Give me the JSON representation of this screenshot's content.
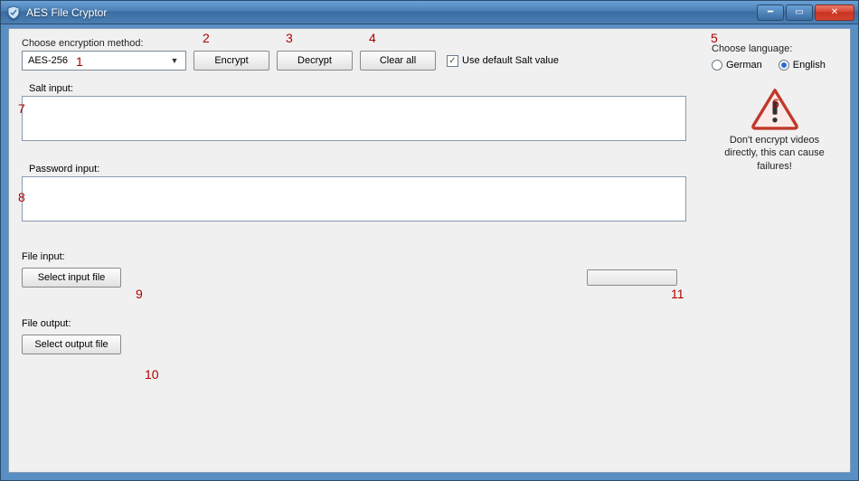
{
  "titlebar": {
    "title": "AES File Cryptor"
  },
  "form": {
    "method_label": "Choose encryption method:",
    "method_value": "AES-256",
    "encrypt_label": "Encrypt",
    "decrypt_label": "Decrypt",
    "clear_label": "Clear all",
    "use_default_salt_label": "Use default Salt value",
    "use_default_salt_checked": true,
    "salt_label": "Salt input:",
    "salt_value": "",
    "password_label": "Password input:",
    "password_value": "",
    "file_input_label": "File input:",
    "select_input_label": "Select input file",
    "file_output_label": "File output:",
    "select_output_label": "Select output file"
  },
  "right": {
    "language_label": "Choose language:",
    "german_label": "German",
    "english_label": "English",
    "selected_language": "English",
    "warning_text": "Don't encrypt videos directly, this can cause failures!"
  },
  "annotations": {
    "a1": "1",
    "a2": "2",
    "a3": "3",
    "a4": "4",
    "a5": "5",
    "a6": "6",
    "a7": "7",
    "a8": "8",
    "a9": "9",
    "a10": "10",
    "a11": "11"
  }
}
